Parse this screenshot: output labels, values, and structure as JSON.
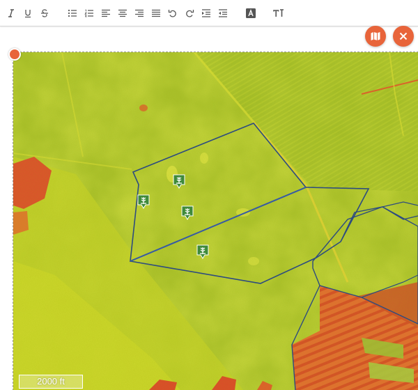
{
  "colors": {
    "accent": "#e8643a",
    "marker_green": "#3f8a3a",
    "boundary_blue": "#1f3f8f",
    "field_green": "#a8c02c",
    "field_yellow": "#d9e02a",
    "field_red": "#e0522c"
  },
  "toolbar": {
    "buttons": [
      {
        "name": "italic-button",
        "icon": "italic-icon"
      },
      {
        "name": "underline-button",
        "icon": "underline-icon"
      },
      {
        "name": "strikethrough-button",
        "icon": "strikethrough-icon"
      },
      {
        "name": "bulleted-list-button",
        "icon": "bulleted-list-icon"
      },
      {
        "name": "numbered-list-button",
        "icon": "numbered-list-icon"
      },
      {
        "name": "align-left-button",
        "icon": "align-left-icon"
      },
      {
        "name": "align-center-button",
        "icon": "align-center-icon"
      },
      {
        "name": "align-right-button",
        "icon": "align-right-icon"
      },
      {
        "name": "align-justify-button",
        "icon": "align-justify-icon"
      },
      {
        "name": "undo-button",
        "icon": "undo-icon"
      },
      {
        "name": "redo-button",
        "icon": "redo-icon"
      },
      {
        "name": "indent-button",
        "icon": "indent-icon"
      },
      {
        "name": "outdent-button",
        "icon": "outdent-icon"
      },
      {
        "name": "text-color-button",
        "icon": "text-color-icon"
      },
      {
        "name": "font-size-button",
        "icon": "font-size-icon"
      }
    ]
  },
  "actions": {
    "map_icon": "map-icon",
    "close_icon": "close-icon"
  },
  "map": {
    "scale_label": "2000 ft",
    "marker_icon": "crop-marker-icon",
    "marker_count": 4
  }
}
